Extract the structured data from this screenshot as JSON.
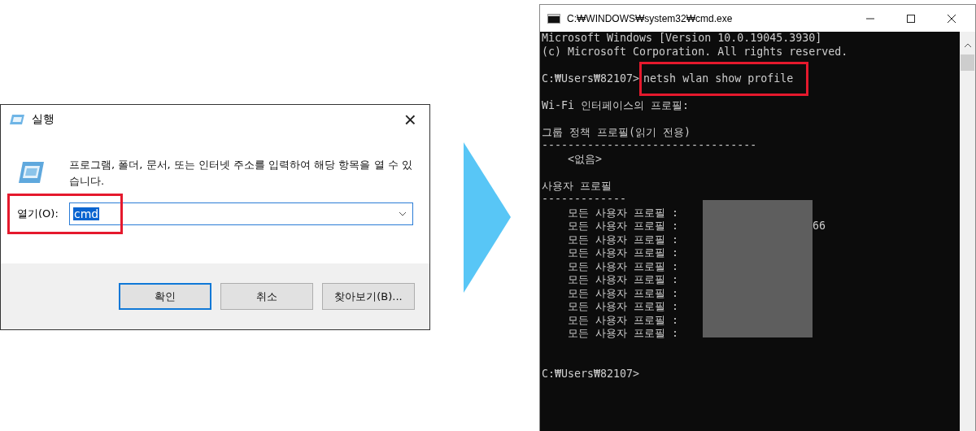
{
  "run_dialog": {
    "title": "실행",
    "close": "×",
    "description": "프로그램, 폴더, 문서, 또는 인터넷 주소를 입력하여 해당 항목을 열 수 있습니다.",
    "open_label": "열기(O):",
    "open_value": "cmd",
    "highlighted": true,
    "buttons": [
      {
        "label": "확인",
        "default": true
      },
      {
        "label": "취소",
        "default": false
      },
      {
        "label": "찾아보기(B)...",
        "default": false
      }
    ]
  },
  "cmd_window": {
    "title": "C:₩WINDOWS₩system32₩cmd.exe",
    "lines": [
      {
        "kind": "text",
        "text": "Microsoft Windows [Version 10.0.19045.3930]"
      },
      {
        "kind": "text",
        "text": "(c) Microsoft Corporation. All rights reserved."
      },
      {
        "kind": "blank"
      },
      {
        "kind": "prompt",
        "prompt": "C:₩Users₩82107>",
        "command": "netsh wlan show profile",
        "highlighted": true
      },
      {
        "kind": "blank"
      },
      {
        "kind": "text",
        "text": "Wi-Fi 인터페이스의 프로필:"
      },
      {
        "kind": "blank"
      },
      {
        "kind": "text",
        "text": "그룹 정책 프로필(읽기 전용)"
      },
      {
        "kind": "text",
        "text": "---------------------------------"
      },
      {
        "kind": "text",
        "text": "    <없음>"
      },
      {
        "kind": "blank"
      },
      {
        "kind": "text",
        "text": "사용자 프로필"
      },
      {
        "kind": "text",
        "text": "-------------"
      },
      {
        "kind": "profiles",
        "items": [
          {
            "label": "    모든 사용자 프로필 :"
          },
          {
            "label": "    모든 사용자 프로필 :",
            "value": "66"
          },
          {
            "label": "    모든 사용자 프로필 :"
          },
          {
            "label": "    모든 사용자 프로필 :"
          },
          {
            "label": "    모든 사용자 프로필 :"
          },
          {
            "label": "    모든 사용자 프로필 :"
          },
          {
            "label": "    모든 사용자 프로필 :"
          },
          {
            "label": "    모든 사용자 프로필 :"
          },
          {
            "label": "    모든 사용자 프로필 :"
          },
          {
            "label": "    모든 사용자 프로필 :"
          }
        ]
      },
      {
        "kind": "blank"
      },
      {
        "kind": "blank"
      },
      {
        "kind": "prompt",
        "prompt": "C:₩Users₩82107>",
        "highlighted": false
      }
    ]
  }
}
